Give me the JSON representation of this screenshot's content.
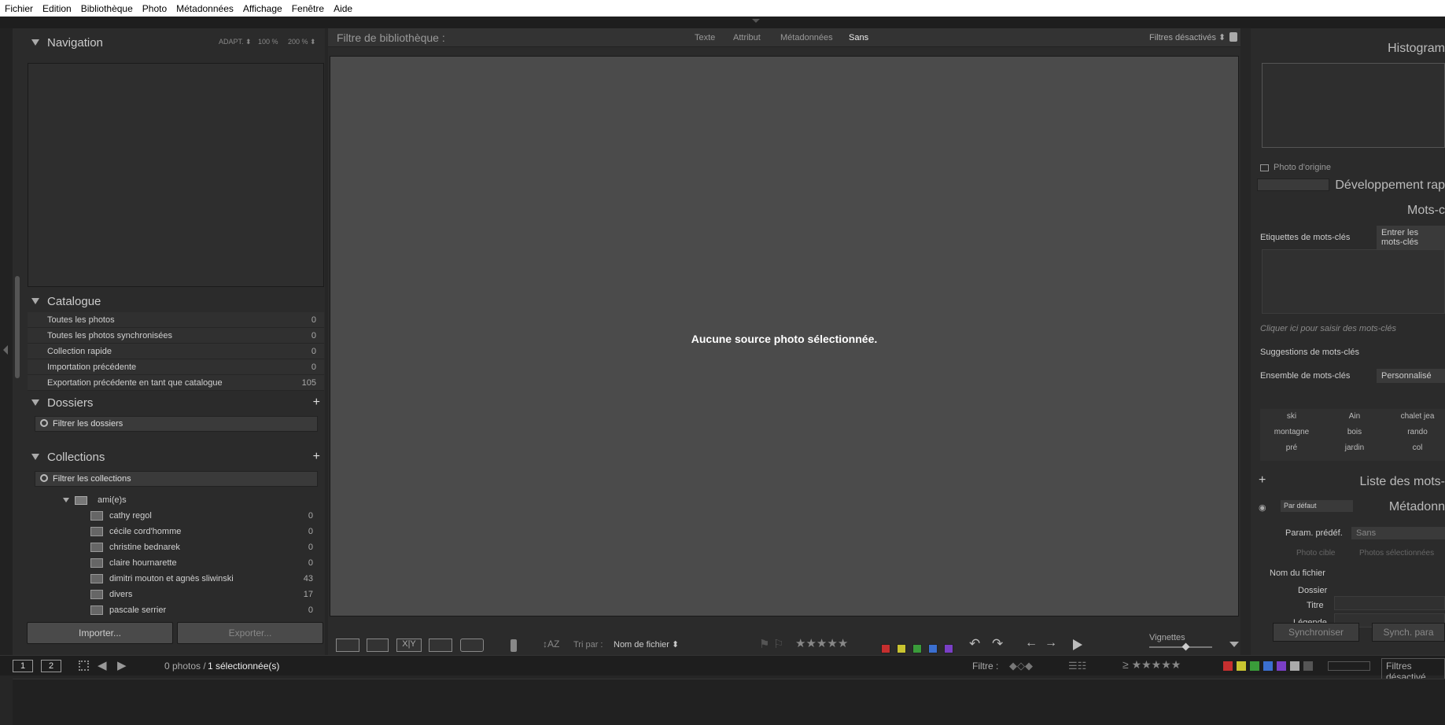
{
  "menu": [
    "Fichier",
    "Edition",
    "Bibliothèque",
    "Photo",
    "Métadonnées",
    "Affichage",
    "Fenêtre",
    "Aide"
  ],
  "left": {
    "navigation": {
      "title": "Navigation",
      "opt1": "ADAPT. ⬍",
      "opt2": "100 %",
      "opt3": "200 % ⬍"
    },
    "catalogue": {
      "title": "Catalogue",
      "items": [
        {
          "label": "Toutes les photos",
          "count": "0"
        },
        {
          "label": "Toutes les photos synchronisées",
          "count": "0"
        },
        {
          "label": "Collection rapide",
          "count": "0"
        },
        {
          "label": "Importation précédente",
          "count": "0"
        },
        {
          "label": "Exportation précédente en tant que catalogue",
          "count": "105"
        }
      ]
    },
    "dossiers": {
      "title": "Dossiers",
      "filter": "Filtrer les dossiers"
    },
    "collections": {
      "title": "Collections",
      "filter": "Filtrer les collections",
      "group": "ami(e)s",
      "items": [
        {
          "label": "cathy regol",
          "count": "0"
        },
        {
          "label": "cécile cord'homme",
          "count": "0"
        },
        {
          "label": "christine bednarek",
          "count": "0"
        },
        {
          "label": "claire hournarette",
          "count": "0"
        },
        {
          "label": "dimitri mouton et agnès sliwinski",
          "count": "43"
        },
        {
          "label": "divers",
          "count": "17"
        },
        {
          "label": "pascale serrier",
          "count": "0"
        }
      ]
    },
    "import_btn": "Importer...",
    "export_btn": "Exporter..."
  },
  "center": {
    "filter_label": "Filtre de bibliothèque :",
    "filter_tabs": [
      "Texte",
      "Attribut",
      "Métadonnées",
      "Sans"
    ],
    "filter_state": "Filtres désactivés ⬍",
    "message": "Aucune source photo sélectionnée.",
    "sort_label": "Tri par :",
    "sort_value": "Nom de fichier ⬍",
    "thumb_label": "Vignettes"
  },
  "right": {
    "histogram": "Histogram",
    "original_photo": "Photo d'origine",
    "quick_dev": "Développement rap",
    "keywords": "Mots-c",
    "kw_tags_label": "Etiquettes de mots-clés",
    "kw_tags_value": "Entrer les mots-clés",
    "kw_hint": "Cliquer ici pour saisir des mots-clés",
    "kw_suggestions": "Suggestions de mots-clés",
    "kw_set_label": "Ensemble de mots-clés",
    "kw_set_value": "Personnalisé",
    "kw_cells": [
      "ski",
      "Ain",
      "chalet jea",
      "montagne",
      "bois",
      "rando",
      "pré",
      "jardin",
      "col"
    ],
    "kw_list": "Liste des mots-",
    "meta_preset": "Par défaut",
    "metadata": "Métadonn",
    "param_label": "Param. prédéf.",
    "param_value": "Sans",
    "photo_cible": "Photo cible",
    "photos_sel": "Photos sélectionnées",
    "fields": [
      "Nom du fichier",
      "Dossier",
      "Titre",
      "Légende"
    ],
    "sync_btn": "Synchroniser",
    "sync_param_btn": "Synch. para"
  },
  "bottom": {
    "page1": "1",
    "page2": "2",
    "status_prefix": "0 photos / ",
    "status_sel": "1 sélectionnée(s)",
    "filter_label": "Filtre :",
    "filter_state": "Filtres désactivé"
  },
  "colors": {
    "red": "#c62f2f",
    "yellow": "#c9c430",
    "green": "#3a9c3a",
    "blue": "#3b6fd0",
    "purple": "#7a3fc6"
  }
}
